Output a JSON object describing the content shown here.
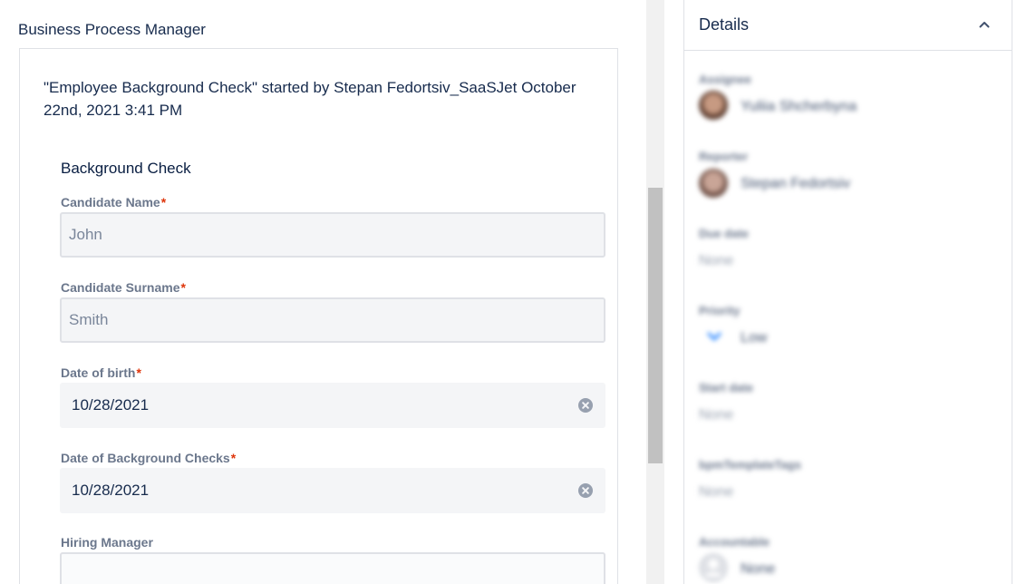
{
  "page": {
    "section_title": "Business Process Manager"
  },
  "process": {
    "headline": "\"Employee Background Check\" started by Stepan Fedortsiv_SaaSJet October 22nd, 2021 3:41 PM",
    "form_title": "Background Check",
    "fields": {
      "candidate_name": {
        "label": "Candidate Name",
        "required": "*",
        "value": "John"
      },
      "candidate_surname": {
        "label": "Candidate Surname",
        "required": "*",
        "value": "Smith"
      },
      "date_of_birth": {
        "label": "Date of birth",
        "required": "*",
        "value": "10/28/2021",
        "clear_icon": "clear-circle-icon"
      },
      "date_of_checks": {
        "label": "Date of Background Checks",
        "required": "*",
        "value": "10/28/2021",
        "clear_icon": "clear-circle-icon"
      },
      "hiring_manager": {
        "label": "Hiring Manager",
        "value": ""
      }
    }
  },
  "details": {
    "title": "Details",
    "collapse_icon": "chevron-up-icon",
    "assignee": {
      "label": "Assignee",
      "name": "Yuliia Shcherbyna"
    },
    "reporter": {
      "label": "Reporter",
      "name": "Stepan Fedortsiv"
    },
    "due_date": {
      "label": "Due date",
      "value": "None"
    },
    "priority": {
      "label": "Priority",
      "value": "Low",
      "icon": "chevron-down-icon",
      "color": "#2684ff"
    },
    "start_date": {
      "label": "Start date",
      "value": "None"
    },
    "template_tags": {
      "label": "bpmTemplateTags",
      "value": "None"
    },
    "accountable": {
      "label": "Accountable",
      "value": "None"
    }
  }
}
